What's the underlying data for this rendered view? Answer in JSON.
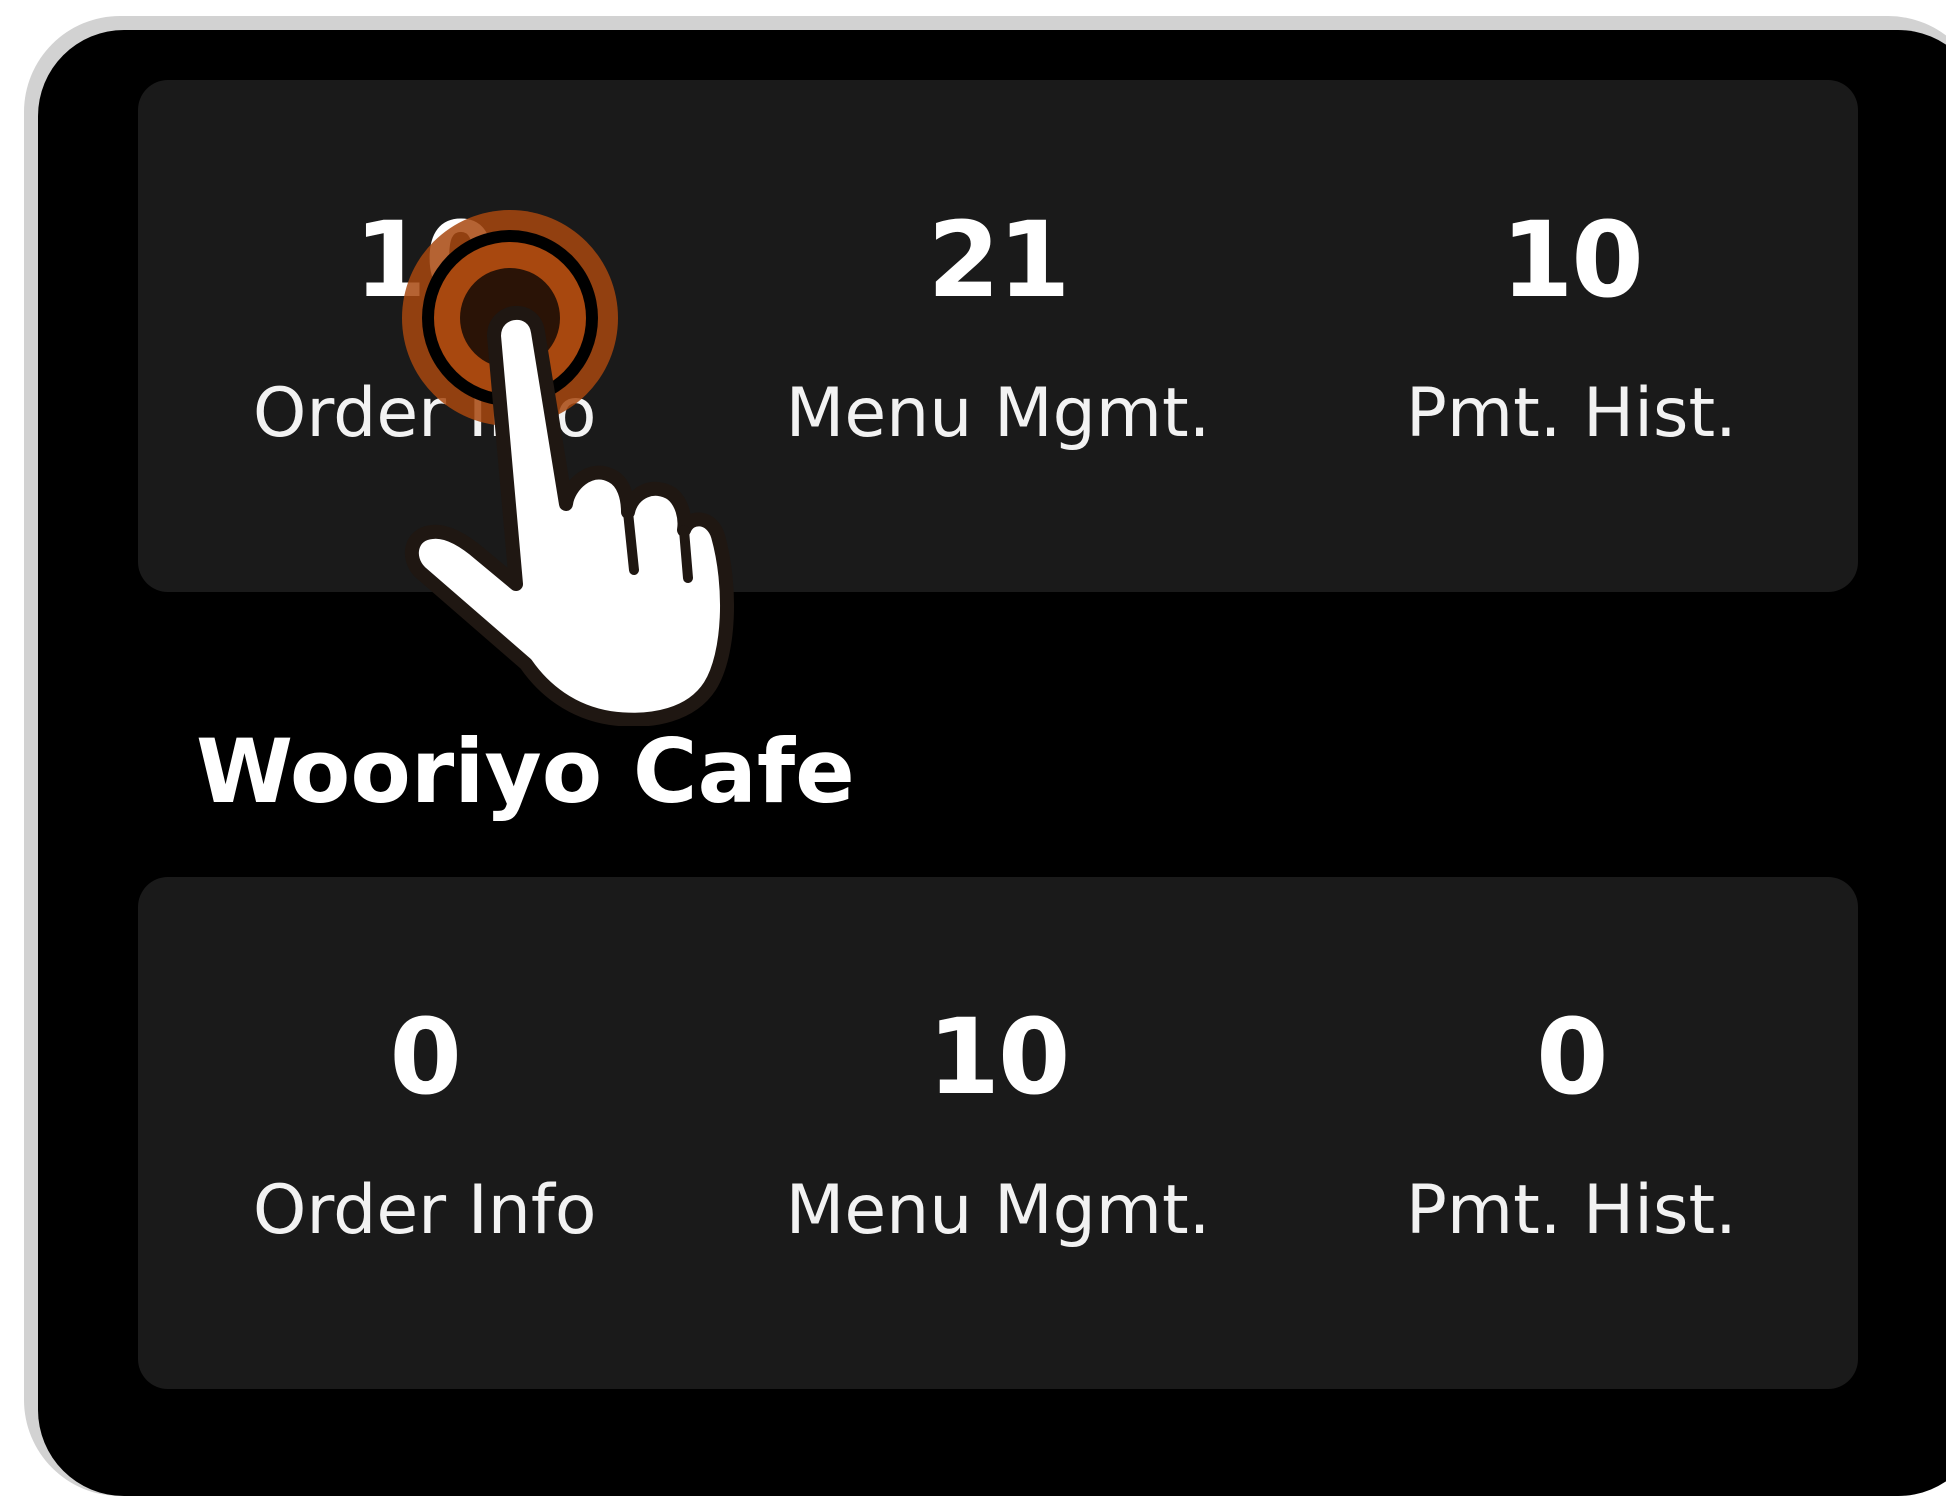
{
  "store_top": {
    "stats": [
      {
        "value": "10",
        "label": "Order Info"
      },
      {
        "value": "21",
        "label": "Menu Mgmt."
      },
      {
        "value": "10",
        "label": "Pmt. Hist."
      }
    ]
  },
  "store_bottom": {
    "name": "Wooriyo Cafe",
    "stats": [
      {
        "value": "0",
        "label": "Order Info"
      },
      {
        "value": "10",
        "label": "Menu Mgmt."
      },
      {
        "value": "0",
        "label": "Pmt. Hist."
      }
    ]
  },
  "overlay": {
    "icon": "tap-hand-icon",
    "accent_color": "#a8480f"
  },
  "colors": {
    "screen_bg": "#000000",
    "card_bg": "#1a1a1a",
    "frame": "#d2d2d2",
    "text": "#ffffff"
  }
}
